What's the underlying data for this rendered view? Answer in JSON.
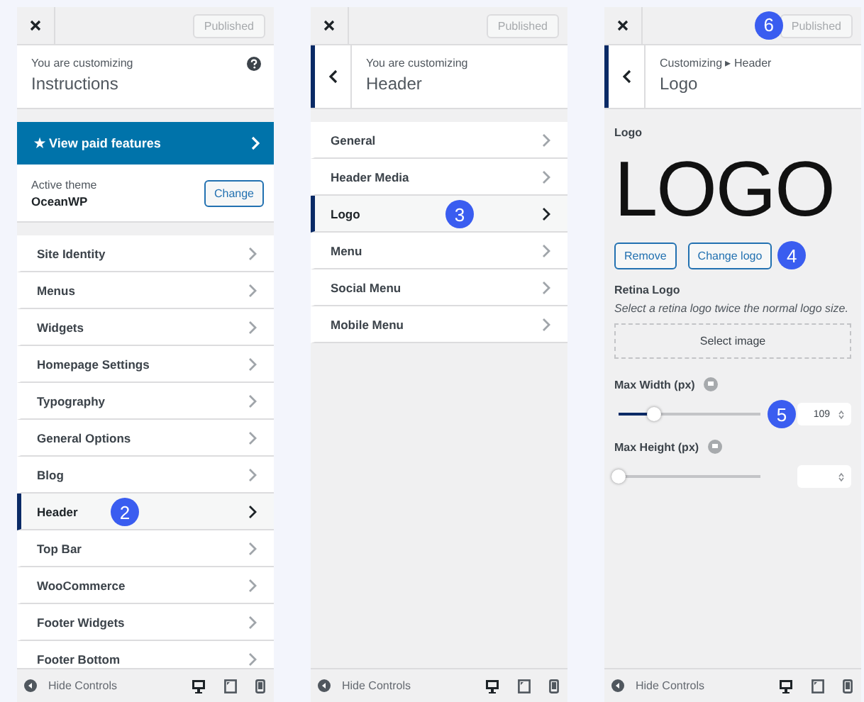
{
  "panels": [
    {
      "kind": "menu",
      "header": {
        "published": "Published"
      },
      "context": {
        "back": false,
        "help": true,
        "label": "You are customizing",
        "title": "Instructions"
      },
      "promo": {
        "text": "★ View paid features"
      },
      "theme": {
        "label": "Active theme",
        "name": "OceanWP",
        "button": "Change"
      },
      "items": [
        {
          "label": "Site Identity",
          "selected": false
        },
        {
          "label": "Menus",
          "selected": false
        },
        {
          "label": "Widgets",
          "selected": false
        },
        {
          "label": "Homepage Settings",
          "selected": false
        },
        {
          "label": "Typography",
          "selected": false
        },
        {
          "label": "General Options",
          "selected": false
        },
        {
          "label": "Blog",
          "selected": false
        },
        {
          "label": "Header",
          "selected": true,
          "badge": "2"
        },
        {
          "label": "Top Bar",
          "selected": false
        },
        {
          "label": "WooCommerce",
          "selected": false
        },
        {
          "label": "Footer Widgets",
          "selected": false
        },
        {
          "label": "Footer Bottom",
          "selected": false
        }
      ],
      "footer": {
        "text": "Hide Controls"
      }
    },
    {
      "kind": "menu",
      "header": {
        "published": "Published"
      },
      "context": {
        "back": true,
        "help": false,
        "label": "You are customizing",
        "title": "Header"
      },
      "items": [
        {
          "label": "General",
          "selected": false
        },
        {
          "label": "Header Media",
          "selected": false
        },
        {
          "label": "Logo",
          "selected": true,
          "badge": "3"
        },
        {
          "label": "Menu",
          "selected": false
        },
        {
          "label": "Social Menu",
          "selected": false
        },
        {
          "label": "Mobile Menu",
          "selected": false
        }
      ],
      "footer": {
        "text": "Hide Controls"
      }
    },
    {
      "kind": "logo",
      "header": {
        "published": "Published",
        "badge": "6"
      },
      "context": {
        "back": true,
        "help": false,
        "label": "Customizing ▸ Header",
        "title": "Logo"
      },
      "logo": {
        "label": "Logo",
        "preview": "LOGO",
        "buttons": [
          {
            "label": "Remove"
          },
          {
            "label": "Change logo",
            "badge": "4"
          }
        ]
      },
      "retina": {
        "label": "Retina Logo",
        "description": "Select a retina logo twice the normal logo size.",
        "button": "Select image"
      },
      "sliders": [
        {
          "label": "Max Width (px)",
          "level": 0.24,
          "value": "109",
          "badge": "5"
        },
        {
          "label": "Max Height (px)",
          "level": 0
        }
      ],
      "footer": {
        "text": "Hide Controls"
      }
    }
  ]
}
